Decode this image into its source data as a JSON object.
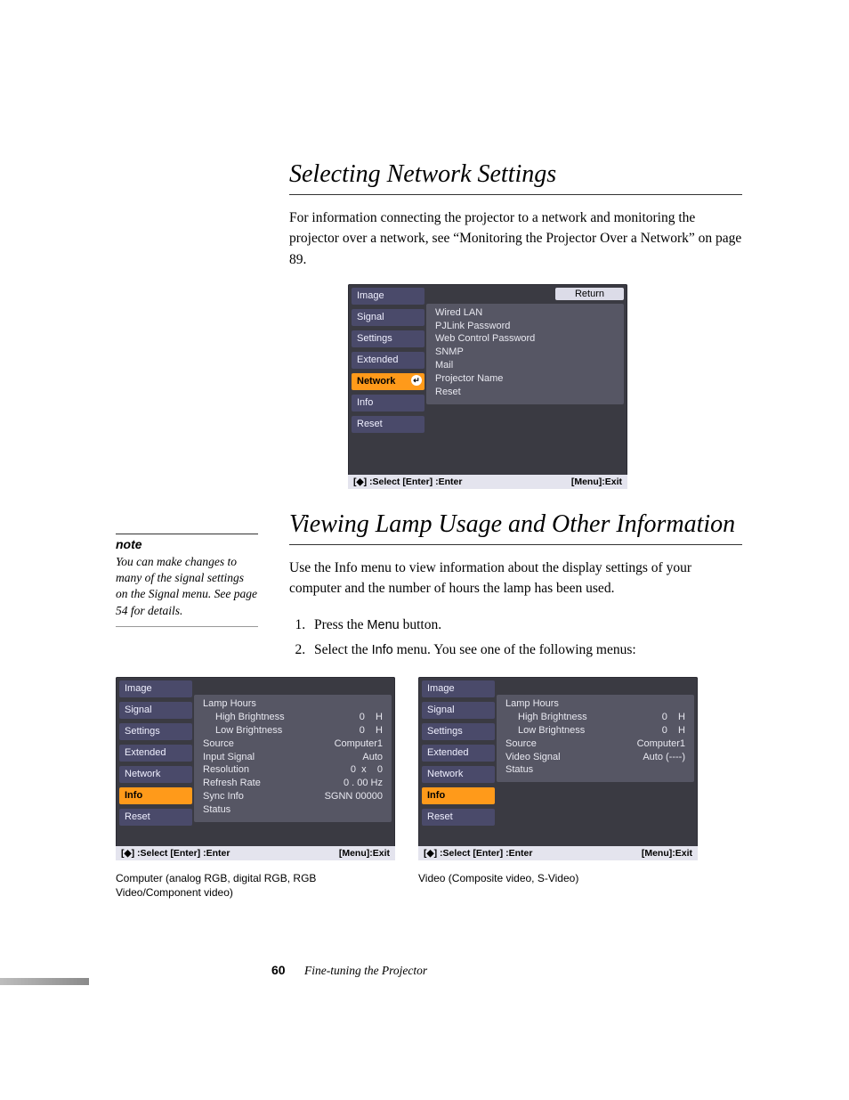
{
  "section1": {
    "heading": "Selecting Network Settings",
    "para": "For information connecting the projector to a network and monitoring the projector over a network, see “Monitoring the Projector Over a Network” on page 89."
  },
  "osd1": {
    "sidebar": [
      "Image",
      "Signal",
      "Settings",
      "Extended",
      "Network",
      "Info",
      "Reset"
    ],
    "selected": "Network",
    "return": "Return",
    "content": [
      "Wired LAN",
      "PJLink Password",
      "Web Control Password",
      "SNMP",
      "Mail",
      "Projector Name",
      "Reset"
    ],
    "footer_left": "[◆] :Select  [Enter] :Enter",
    "footer_right": "[Menu]:Exit"
  },
  "section2": {
    "heading": "Viewing Lamp Usage and Other Information",
    "para": "Use the Info menu to view information about the display settings of your computer and the number of hours the lamp has been used.",
    "steps": [
      {
        "pre": "Press the ",
        "sans": "Menu",
        "post": " button."
      },
      {
        "pre": "Select the ",
        "sans": "Info",
        "post": " menu. You see one of the following menus:"
      }
    ]
  },
  "note": {
    "label": "note",
    "text": "You can make changes to many of the signal settings on the Signal menu. See page 54 for details."
  },
  "osd2": {
    "sidebar": [
      "Image",
      "Signal",
      "Settings",
      "Extended",
      "Network",
      "Info",
      "Reset"
    ],
    "selected": "Info",
    "rows": [
      {
        "label": "Lamp Hours",
        "value": ""
      },
      {
        "label_indent": "High Brightness",
        "value": "0    H"
      },
      {
        "label_indent": "Low Brightness",
        "value": "0    H"
      },
      {
        "label": "Source",
        "value": "Computer1"
      },
      {
        "label": "Input Signal",
        "value": "Auto"
      },
      {
        "label": "Resolution",
        "value": "0  x    0"
      },
      {
        "label": "Refresh Rate",
        "value": "0 . 00 Hz"
      },
      {
        "label": "Sync Info",
        "value": "SGNN 00000"
      },
      {
        "label": "Status",
        "value": ""
      }
    ],
    "footer_left": "[◆] :Select  [Enter] :Enter",
    "footer_right": "[Menu]:Exit",
    "caption": "Computer (analog RGB, digital RGB, RGB Video/Component video)"
  },
  "osd3": {
    "sidebar": [
      "Image",
      "Signal",
      "Settings",
      "Extended",
      "Network",
      "Info",
      "Reset"
    ],
    "selected": "Info",
    "rows": [
      {
        "label": "Lamp Hours",
        "value": ""
      },
      {
        "label_indent": "High Brightness",
        "value": "0    H"
      },
      {
        "label_indent": "Low Brightness",
        "value": "0    H"
      },
      {
        "label": "Source",
        "value": "Computer1"
      },
      {
        "label": "Video Signal",
        "value": "Auto (----)"
      },
      {
        "label": "Status",
        "value": ""
      }
    ],
    "footer_left": "[◆] :Select  [Enter] :Enter",
    "footer_right": "[Menu]:Exit",
    "caption": "Video (Composite video, S-Video)"
  },
  "footer": {
    "page": "60",
    "title": "Fine-tuning the Projector"
  }
}
